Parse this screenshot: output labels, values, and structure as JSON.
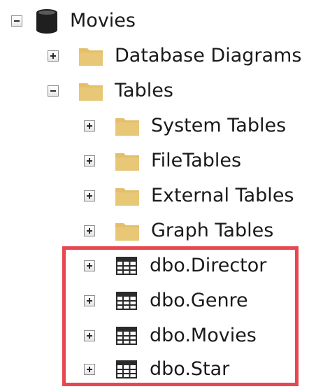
{
  "tree": {
    "root": {
      "label": "Movies",
      "expander": "minus",
      "icon": "database-icon"
    },
    "database_diagrams": {
      "label": "Database Diagrams",
      "expander": "plus",
      "icon": "folder-icon"
    },
    "tables": {
      "label": "Tables",
      "expander": "minus",
      "icon": "folder-icon"
    },
    "system_tables": {
      "label": "System Tables",
      "expander": "plus",
      "icon": "folder-icon"
    },
    "file_tables": {
      "label": "FileTables",
      "expander": "plus",
      "icon": "folder-icon"
    },
    "external_tables": {
      "label": "External Tables",
      "expander": "plus",
      "icon": "folder-icon"
    },
    "graph_tables": {
      "label": "Graph Tables",
      "expander": "plus",
      "icon": "folder-icon"
    },
    "user_tables": [
      {
        "label": "dbo.Director",
        "expander": "plus",
        "icon": "table-icon"
      },
      {
        "label": "dbo.Genre",
        "expander": "plus",
        "icon": "table-icon"
      },
      {
        "label": "dbo.Movies",
        "expander": "plus",
        "icon": "table-icon"
      },
      {
        "label": "dbo.Star",
        "expander": "plus",
        "icon": "table-icon"
      }
    ]
  },
  "colors": {
    "folder": "#e3bf6b",
    "highlight_border": "#e8474f",
    "text": "#1a1a1a"
  }
}
